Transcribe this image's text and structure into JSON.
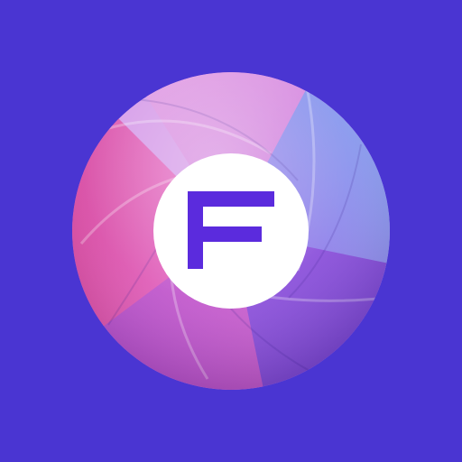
{
  "icon": {
    "name": "camera-aperture-app-icon",
    "glyph": "F",
    "colors": {
      "background": "#4A35D2",
      "glyph": "#5B2BDD",
      "badge": "#FFFFFF",
      "aperture_pink": "#E45BC6",
      "aperture_magenta": "#C53FB8",
      "aperture_lavender": "#D59AE8",
      "aperture_violet": "#8B4FD9",
      "aperture_purple": "#6E3FD0",
      "aperture_blue": "#77A6F2"
    }
  }
}
